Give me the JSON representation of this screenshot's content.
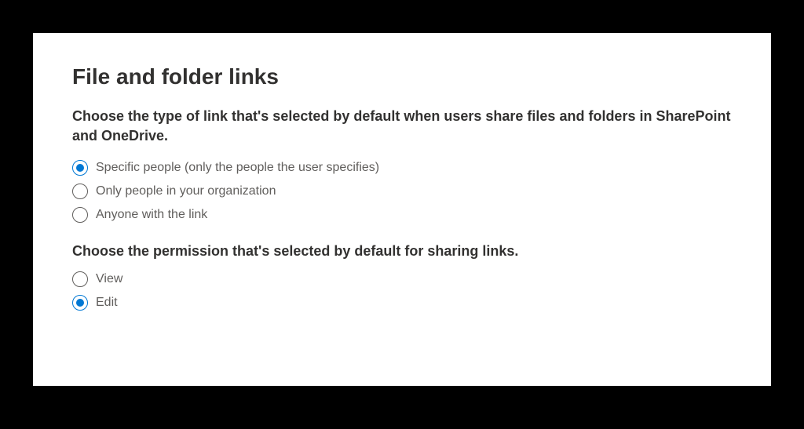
{
  "heading": "File and folder links",
  "linkType": {
    "description": "Choose the type of link that's selected by default when users share files and folders in SharePoint and OneDrive.",
    "options": [
      {
        "label": "Specific people (only the people the user specifies)",
        "selected": true
      },
      {
        "label": "Only people in your organization",
        "selected": false
      },
      {
        "label": "Anyone with the link",
        "selected": false
      }
    ]
  },
  "permission": {
    "description": "Choose the permission that's selected by default for sharing links.",
    "options": [
      {
        "label": "View",
        "selected": false
      },
      {
        "label": "Edit",
        "selected": true
      }
    ]
  }
}
